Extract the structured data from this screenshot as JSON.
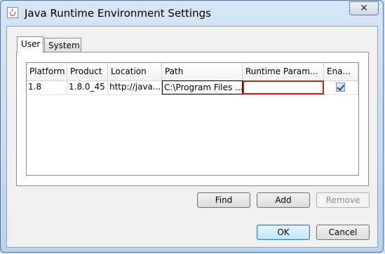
{
  "window": {
    "title": "Java Runtime Environment Settings",
    "close_glyph": "✕"
  },
  "tabs": [
    {
      "label": "User",
      "active": true
    },
    {
      "label": "System",
      "active": false
    }
  ],
  "table": {
    "columns": [
      "Platform",
      "Product",
      "Location",
      "Path",
      "Runtime Param...",
      "Ena..."
    ],
    "rows": [
      {
        "platform": "1.8",
        "product": "1.8.0_45",
        "location": "http://java...",
        "path": "C:\\Program Files ...",
        "runtime_params": "",
        "enabled": true
      }
    ]
  },
  "buttons": {
    "find": "Find",
    "add": "Add",
    "remove": "Remove",
    "ok": "OK",
    "cancel": "Cancel"
  },
  "colors": {
    "highlight_border": "#cc1f1f",
    "window_bg": "#cfe1f5"
  }
}
